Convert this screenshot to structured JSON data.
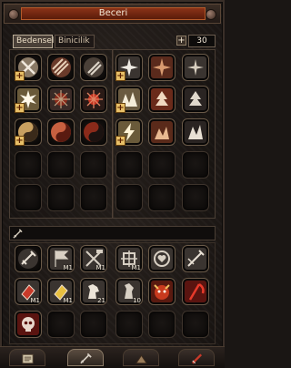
{
  "window": {
    "title": "Beceri"
  },
  "tabs": [
    {
      "label": "Bedensel",
      "active": true
    },
    {
      "label": "Binicilik",
      "active": false
    }
  ],
  "skill_points": "30",
  "plus_label": "+",
  "active_skills": [
    {
      "icon": "crossed-blades-icon",
      "plus": true
    },
    {
      "icon": "slashing-strike-icon",
      "plus": false
    },
    {
      "icon": "spinning-slash-icon",
      "plus": false
    },
    {
      "icon": "burst-star-icon",
      "plus": true
    },
    {
      "icon": "spiral-star-icon",
      "plus": false
    },
    {
      "icon": "sword-burst-icon",
      "plus": false
    },
    {
      "icon": "white-burst-icon",
      "plus": true
    },
    {
      "icon": "spiked-seal-icon",
      "plus": false
    },
    {
      "icon": "red-sunburst-icon",
      "plus": false
    },
    {
      "icon": "mountain-spikes-icon",
      "plus": true
    },
    {
      "icon": "tree-spikes-icon",
      "plus": false
    },
    {
      "icon": "blade-tree-icon",
      "plus": false
    },
    {
      "icon": "yin-yang-gold-icon",
      "plus": true
    },
    {
      "icon": "yin-yang-red-icon",
      "plus": false
    },
    {
      "icon": "yin-yang-dark-icon",
      "plus": false
    },
    {
      "icon": "lightning-burst-icon",
      "plus": true
    },
    {
      "icon": "rune-cluster-icon",
      "plus": false
    },
    {
      "icon": "white-feathers-icon",
      "plus": false
    }
  ],
  "passive_skills": [
    {
      "icon": "sword-swing-icon",
      "badge": ""
    },
    {
      "icon": "battle-flag-icon",
      "badge": "M1"
    },
    {
      "icon": "crossed-tools-icon",
      "badge": "M1"
    },
    {
      "icon": "knot-rune-icon",
      "badge": "M1"
    },
    {
      "icon": "heart-knot-icon",
      "badge": ""
    },
    {
      "icon": "horse-weapon-icon",
      "badge": ""
    },
    {
      "icon": "red-scroll-icon",
      "badge": "M1"
    },
    {
      "icon": "gold-scroll-icon",
      "badge": "M1"
    },
    {
      "icon": "white-horse-icon",
      "badge": "21"
    },
    {
      "icon": "horse-head-icon",
      "badge": "10"
    },
    {
      "icon": "demon-face-icon",
      "badge": ""
    },
    {
      "icon": "red-scythe-icon",
      "badge": ""
    },
    {
      "icon": "red-skull-icon",
      "badge": ""
    }
  ],
  "bottom_tabs": [
    {
      "icon": "skill-book-icon",
      "active": false
    },
    {
      "icon": "sword-tab-icon",
      "active": true
    },
    {
      "icon": "pyramid-tab-icon",
      "active": false
    },
    {
      "icon": "red-blade-tab-icon",
      "active": false
    }
  ]
}
